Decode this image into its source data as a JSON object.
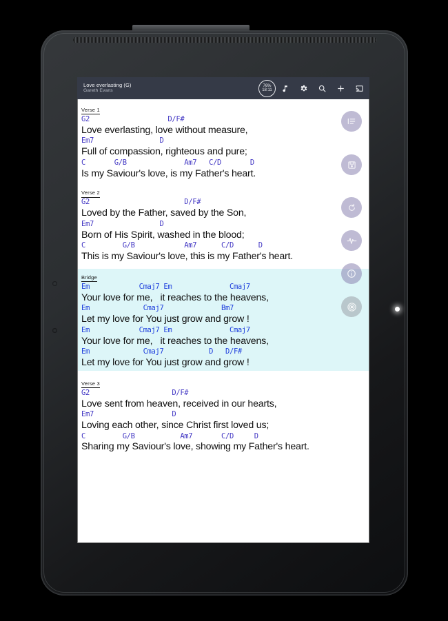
{
  "appbar": {
    "song_title": "Love everlasting (G)",
    "artist": "Gareth Evans",
    "battery_percent": "76%",
    "clock": "18:11",
    "icons": [
      {
        "name": "music-note-icon",
        "label": "Music note"
      },
      {
        "name": "gear-icon",
        "label": "Settings"
      },
      {
        "name": "search-icon",
        "label": "Search"
      },
      {
        "name": "plus-icon",
        "label": "Add"
      },
      {
        "name": "cast-icon",
        "label": "Cast"
      }
    ],
    "bg_color": "#353a47"
  },
  "colors": {
    "verse_chord": "#4338c4",
    "bridge_chord": "#2040dd",
    "bridge_background": "#ddf6f8",
    "lyric": "#101010",
    "fab": "#8b83b0"
  },
  "fabs": [
    {
      "name": "setlist-icon",
      "label": "Set list"
    },
    {
      "name": "save-icon",
      "label": "Save"
    },
    {
      "name": "refresh-icon",
      "label": "Refresh"
    },
    {
      "name": "metronome-pulse-icon",
      "label": "Metronome"
    },
    {
      "name": "info-icon",
      "label": "Info"
    },
    {
      "name": "target-icon",
      "label": "Autoscroll"
    }
  ],
  "sheet": {
    "sections": [
      {
        "label": "Verse 1",
        "highlight": false,
        "lines": [
          {
            "chords": "G2                   D/F#",
            "lyric": "Love everlasting, love without measure,"
          },
          {
            "chords": "Em7                D",
            "lyric": "Full of compassion, righteous and pure;"
          },
          {
            "chords": "C       G/B              Am7   C/D       D",
            "lyric": "Is my Saviour's love, is my Father's heart."
          }
        ]
      },
      {
        "label": "Verse 2",
        "highlight": false,
        "lines": [
          {
            "chords": "G2                       D/F#",
            "lyric": "Loved by the Father, saved by the Son,"
          },
          {
            "chords": "Em7                D",
            "lyric": "Born of His Spirit, washed in the blood;"
          },
          {
            "chords": "C         G/B            Am7      C/D      D",
            "lyric": "This is my Saviour's love, this is my Father's heart."
          }
        ]
      },
      {
        "label": "Bridge",
        "highlight": true,
        "lines": [
          {
            "chords": "Em            Cmaj7 Em              Cmaj7",
            "lyric": "Your love for me,   it reaches to the heavens,"
          },
          {
            "chords": "Em             Cmaj7              Bm7",
            "lyric": "Let my love for You just grow and grow !"
          },
          {
            "chords": "Em            Cmaj7 Em              Cmaj7",
            "lyric": "Your love for me,   it reaches to the heavens,"
          },
          {
            "chords": "Em             Cmaj7           D   D/F#",
            "lyric": "Let my love for You just grow and grow !"
          }
        ]
      },
      {
        "label": "Verse 3",
        "highlight": false,
        "lines": [
          {
            "chords": "G2                    D/F#",
            "lyric": "Love sent from heaven, received in our hearts,"
          },
          {
            "chords": "Em7                   D",
            "lyric": "Loving each other, since Christ first loved us;"
          },
          {
            "chords": "C         G/B           Am7       C/D     D",
            "lyric": "Sharing my Saviour's love, showing my Father's heart."
          }
        ]
      }
    ]
  }
}
